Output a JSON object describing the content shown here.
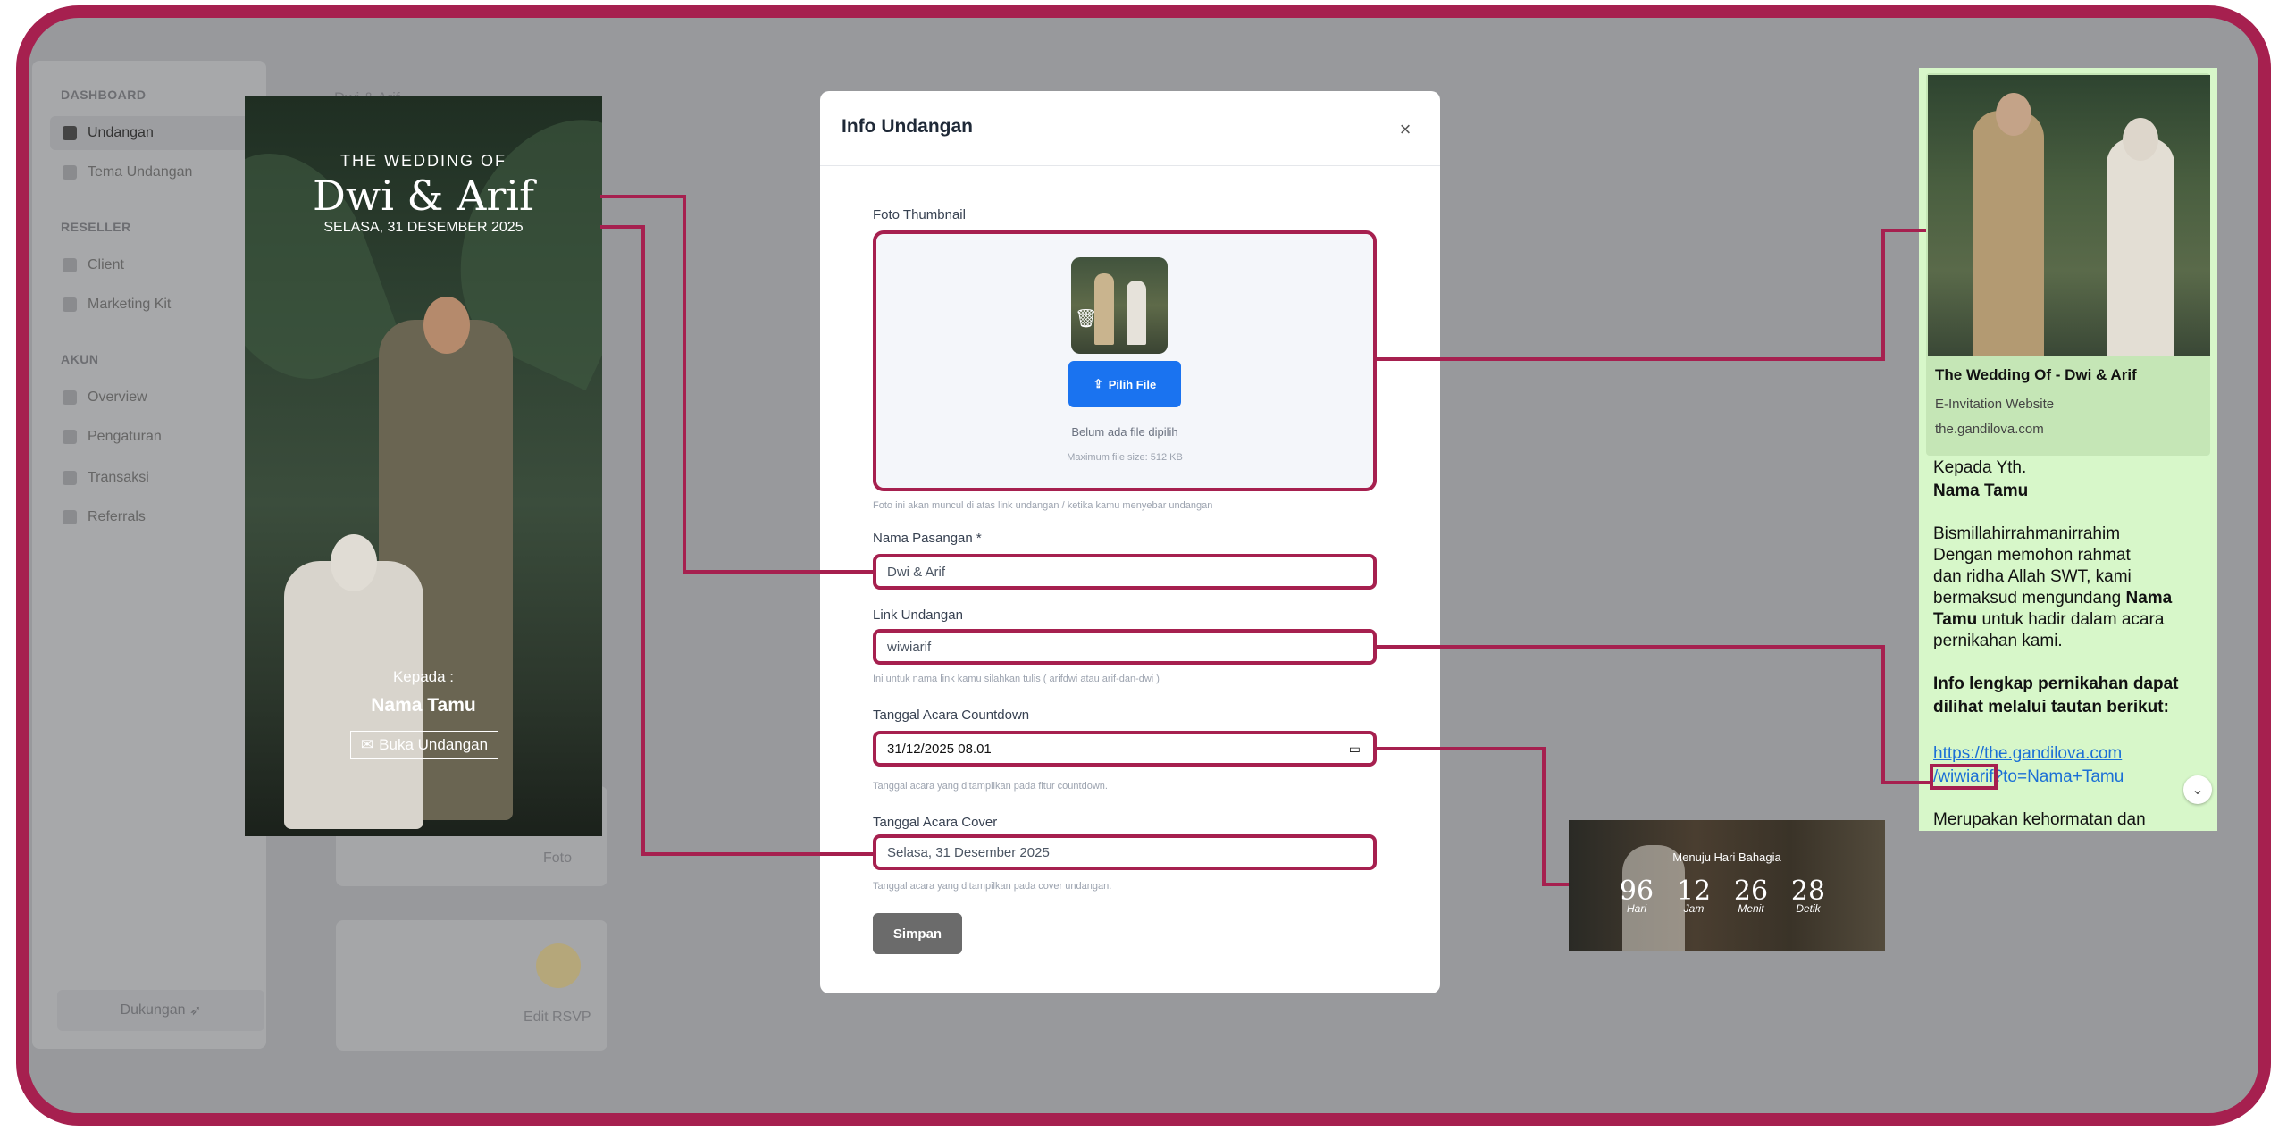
{
  "sidebar": {
    "sections": [
      "DASHBOARD",
      "RESELLER",
      "AKUN"
    ],
    "items": [
      {
        "label": "Undangan"
      },
      {
        "label": "Tema Undangan"
      },
      {
        "label": "Client"
      },
      {
        "label": "Marketing Kit"
      },
      {
        "label": "Overview"
      },
      {
        "label": "Pengaturan"
      },
      {
        "label": "Transaksi"
      },
      {
        "label": "Referrals"
      }
    ],
    "support_label": "Dukungan"
  },
  "background": {
    "header_partial": "Dwi & Arif",
    "foto_label": "Foto",
    "edit_rsvp_label": "Edit RSVP"
  },
  "cover": {
    "subtitle": "THE WEDDING OF",
    "names": "Dwi & Arif",
    "date": "SELASA, 31 DESEMBER 2025",
    "kepada": "Kepada :",
    "guest": "Nama Tamu",
    "open_button": "Buka Undangan"
  },
  "modal": {
    "title": "Info Undangan",
    "close": "×",
    "thumbnail_label": "Foto Thumbnail",
    "choose_file": "Pilih File",
    "no_file": "Belum ada file dipilih",
    "max_size": "Maximum file size: 512 KB",
    "thumbnail_hint": "Foto ini akan muncul di atas link undangan / ketika kamu menyebar undangan",
    "couple_label": "Nama Pasangan *",
    "couple_value": "Dwi & Arif",
    "link_label": "Link Undangan",
    "link_value": "wiwiarif",
    "link_hint": "Ini untuk nama link kamu silahkan tulis ( arifdwi atau arif-dan-dwi )",
    "countdown_label": "Tanggal Acara Countdown",
    "countdown_value": "31/12/2025 08.01",
    "countdown_hint": "Tanggal acara yang ditampilkan pada fitur countdown.",
    "cover_date_label": "Tanggal Acara Cover",
    "cover_date_value": "Selasa, 31 Desember 2025",
    "cover_date_hint": "Tanggal acara yang ditampilkan pada cover undangan.",
    "save": "Simpan"
  },
  "countdown": {
    "title": "Menuju Hari Bahagia",
    "units": [
      {
        "value": "96",
        "label": "Hari"
      },
      {
        "value": "12",
        "label": "Jam"
      },
      {
        "value": "26",
        "label": "Menit"
      },
      {
        "value": "28",
        "label": "Detik"
      }
    ]
  },
  "whatsapp": {
    "card_title": "The Wedding Of - Dwi & Arif",
    "card_desc": "E-Invitation Website",
    "card_domain": "the.gandilova.com",
    "greeting": "Kepada Yth.",
    "guest": "Nama Tamu",
    "bismillah": "Bismillahirrahmanirrahim",
    "line1": "Dengan memohon rahmat",
    "line2": "dan ridha Allah SWT, kami",
    "line3a": "bermaksud mengundang ",
    "line3b": "Nama",
    "line4a": "Tamu",
    "line4b": " untuk hadir dalam acara",
    "line5": "pernikahan kami.",
    "info1": "Info lengkap pernikahan dapat",
    "info2": "dilihat melalui tautan berikut:",
    "link1": "https://the.gandilova.com",
    "link2a": "/wiwiarif",
    "link2b": "?to=Nama+Tamu",
    "trailing": "Merupakan kehormatan dan"
  },
  "colors": {
    "accent": "#a6204f",
    "primary_button": "#1a73f0",
    "save_button": "#6b6b6b",
    "whatsapp_bg": "#d7f7c9"
  }
}
